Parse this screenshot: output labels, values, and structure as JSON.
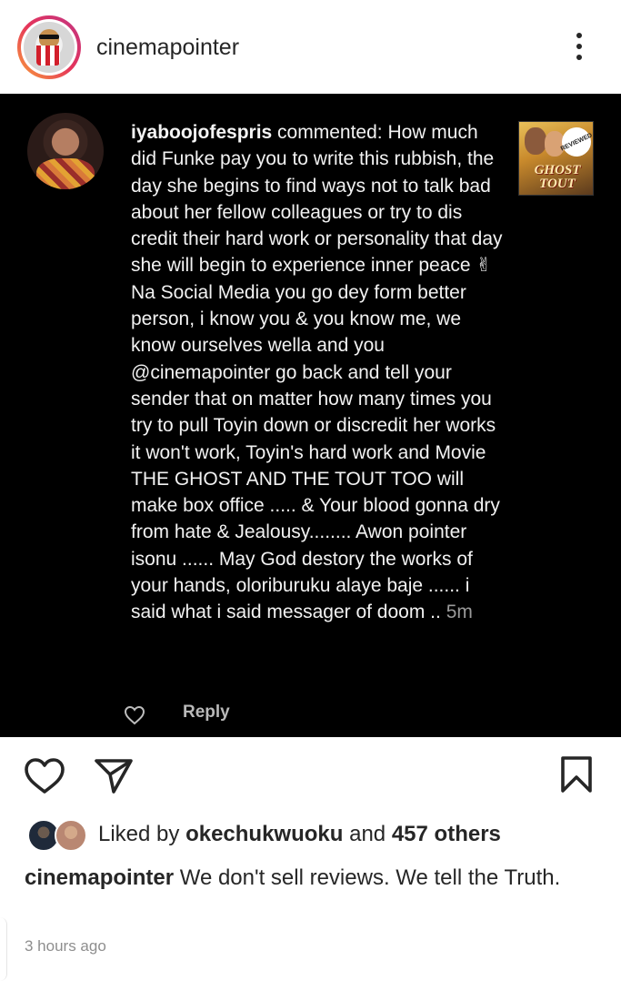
{
  "header": {
    "username": "cinemapointer",
    "avatar_icon": "popcorn-dog-avatar",
    "more_icon": "more-vertical-icon"
  },
  "post": {
    "comment": {
      "username": "iyaboojofespris",
      "verb": "commented:",
      "text": "How much did Funke pay you to write this rubbish, the day she begins to find ways not to talk bad about her fellow colleagues or try to dis credit their hard work or personality that day she will begin to experience inner peace ✌ Na Social Media you go dey form better person, i know you & you know me, we know ourselves wella and you @cinemapointer go back and tell your sender that on matter how many times you try to pull Toyin down or discredit her works it won't work, Toyin's hard work and Movie THE GHOST AND THE TOUT TOO will make box office ..... & Your blood gonna dry from hate & Jealousy........ Awon pointer isonu ...... May God destory the works of your hands, oloriburuku alaye baje ...... i said what i said messager of doom ..",
      "time": "5m",
      "reply_label": "Reply"
    },
    "thumbnail": {
      "badge": "REVIEWED",
      "title_line1": "GHOST",
      "title_line2": "TOUT"
    }
  },
  "actions": {
    "like_icon": "heart-icon",
    "share_icon": "send-icon",
    "save_icon": "bookmark-icon"
  },
  "likes": {
    "prefix": "Liked by",
    "user": "okechukwuoku",
    "middle": "and",
    "others": "457 others"
  },
  "caption": {
    "username": "cinemapointer",
    "text": "We don't sell reviews. We tell the Truth."
  },
  "timestamp": "3 hours ago"
}
